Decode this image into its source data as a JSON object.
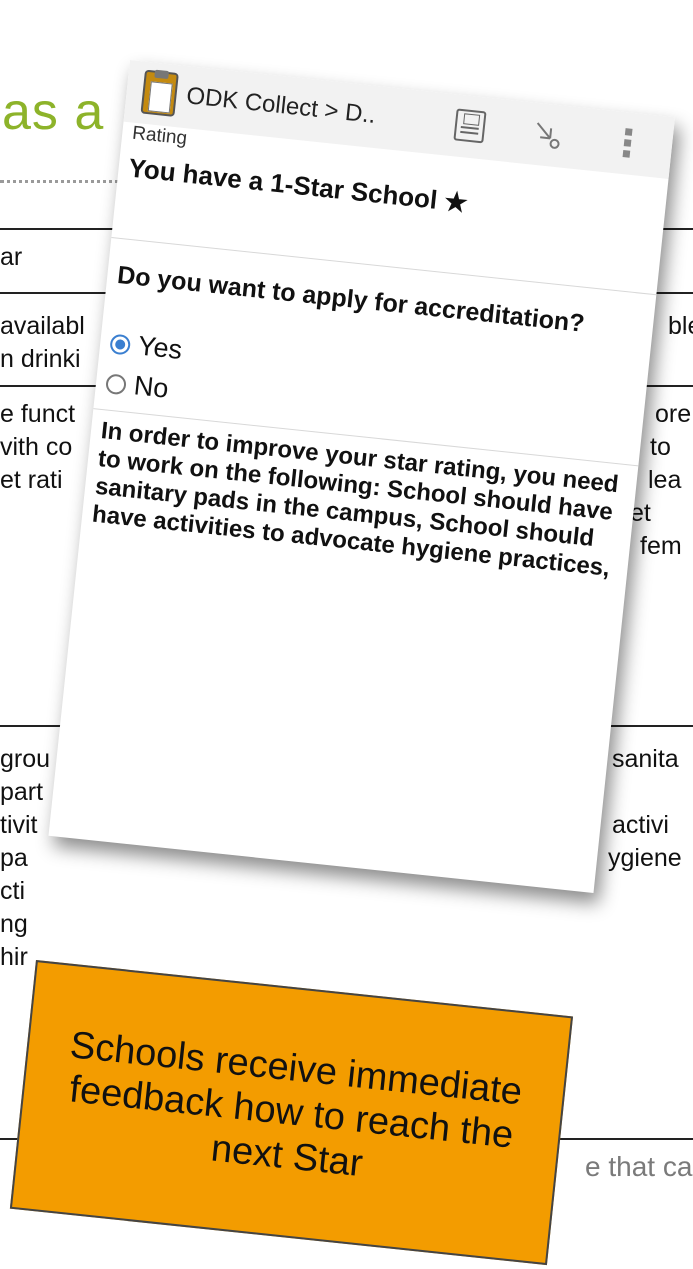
{
  "slide": {
    "title_fragment": "as a",
    "left_rows": [
      [
        "ar"
      ],
      [
        "availabl",
        "n drinki"
      ],
      [
        "e funct",
        "vith co",
        "et rati"
      ],
      [
        "grou",
        "part",
        "tivit",
        "pa",
        "cti",
        "ng",
        "hir"
      ]
    ],
    "right_rows": [
      [
        "ble"
      ],
      [
        "ore",
        "to",
        "lea",
        "et",
        "fem"
      ],
      [
        "sanita",
        "activi",
        "ygiene"
      ]
    ],
    "bottom_right_text": "e that ca"
  },
  "phone": {
    "app_title": "ODK Collect > D..",
    "group_label": "Rating",
    "star_message": "You have a 1-Star School ★",
    "question": "Do you want to apply for accreditation?",
    "options": [
      {
        "label": "Yes",
        "selected": true
      },
      {
        "label": "No",
        "selected": false
      }
    ],
    "feedback": "In order to improve your star rating, you need to work on the following: School should have sanitary pads in the campus, School should have activities to advocate hygiene practices,",
    "icons": {
      "app": "odk-clipboard-icon",
      "save": "save-icon",
      "jump": "go-to-icon",
      "menu": "overflow-menu-icon"
    },
    "accent_color": "#3a7fd0"
  },
  "callout": {
    "text": "Schools receive immediate feedback how to reach the next Star",
    "color": "#f39c00"
  }
}
